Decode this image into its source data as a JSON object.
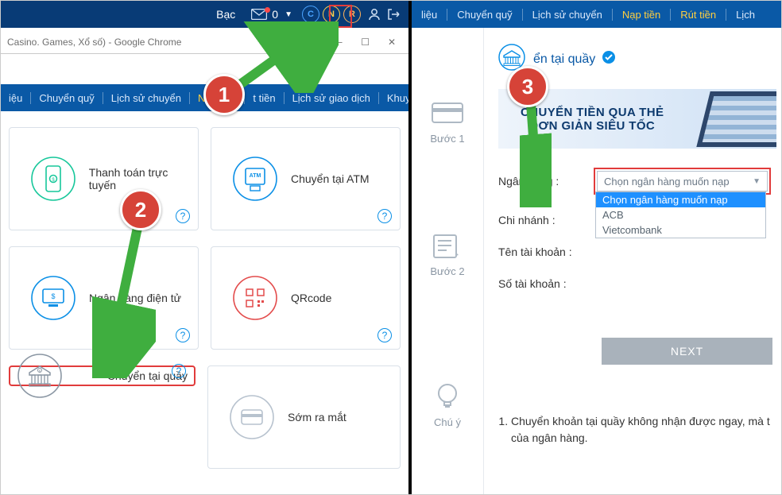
{
  "left": {
    "topbar": {
      "rank": "Bạc",
      "count": "0",
      "c": "C",
      "n": "N",
      "r": "R"
    },
    "chrome_title": "Casino. Games, Xổ số) - Google Chrome",
    "win": {
      "min": "─",
      "max": "☐",
      "close": "✕"
    },
    "nav": {
      "i0": "iệu",
      "i1": "Chuyển quỹ",
      "i2": "Lịch sử chuyển",
      "i3": "Nạp tiền",
      "i4": "t tiền",
      "i5": "Lịch sử giao dịch",
      "i6": "Khuyến mã"
    },
    "cards": {
      "c1": "Thanh toán trực tuyến",
      "c2": "Chuyển tại ATM",
      "c3": "Ngân hàng điện tử",
      "c4": "QRcode",
      "c5": "Chuyển tại quầy",
      "c6": "Sớm ra mắt"
    },
    "help": "?"
  },
  "right": {
    "nav": {
      "i0": "liệu",
      "i1": "Chuyển quỹ",
      "i2": "Lịch sử chuyển",
      "i3": "Nạp tiền",
      "i4": "Rút tiền",
      "i5": "Lịch"
    },
    "steps": {
      "s1": "Bước 1",
      "s2": "Bước 2",
      "note": "Chú ý"
    },
    "title_suffix": "ển tại quầy",
    "hero_l1": "CHUYỂN TIỀN QUA THẺ",
    "hero_l2": "ĐƠN GIẢN SIÊU TỐC",
    "form": {
      "bank": "Ngân hàng :",
      "branch": "Chi nhánh :",
      "accname": "Tên tài khoản :",
      "accno": "Số tài khoản :",
      "placeholder": "Chọn ngân hàng muốn nạp",
      "opt0": "Chọn ngân hàng muốn nạp",
      "opt1": "ACB",
      "opt2": "Vietcombank",
      "next": "NEXT"
    },
    "note_text": "Chuyển khoản tại quầy không nhận được ngay, mà t của ngân hàng."
  },
  "badges": {
    "b1": "1",
    "b2": "2",
    "b3": "3"
  }
}
